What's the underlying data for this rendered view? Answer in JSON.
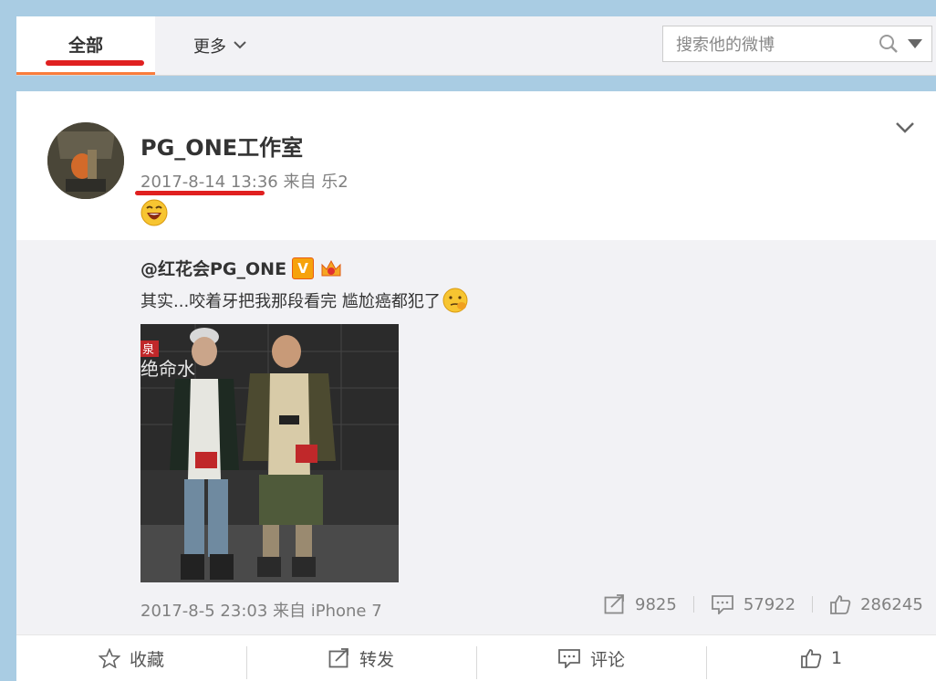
{
  "tabs": {
    "all_label": "全部",
    "more_label": "更多"
  },
  "search": {
    "placeholder": "搜索他的微博"
  },
  "post": {
    "author": "PG_ONE工作室",
    "time": "2017-8-14 13:36",
    "source": "来自 乐2",
    "emoji": "laughing-emoji"
  },
  "repost": {
    "author": "@红花会PG_ONE",
    "verified_badge": "V",
    "text": "其实...咬着牙把我那段看完 尴尬癌都犯了",
    "time": "2017-8-5 23:03 来自 iPhone 7",
    "stats": {
      "forwards": "9825",
      "comments": "57922",
      "likes": "286245"
    },
    "photo_text": {
      "sign_small": "泉",
      "sign_text": "绝命水"
    }
  },
  "actions": {
    "favorite": "收藏",
    "forward": "转发",
    "comment": "评论",
    "like": "1"
  },
  "colors": {
    "accent_orange": "#fa7d3c",
    "annotation_red": "#e02020",
    "badge_orange": "#f6a20c"
  }
}
